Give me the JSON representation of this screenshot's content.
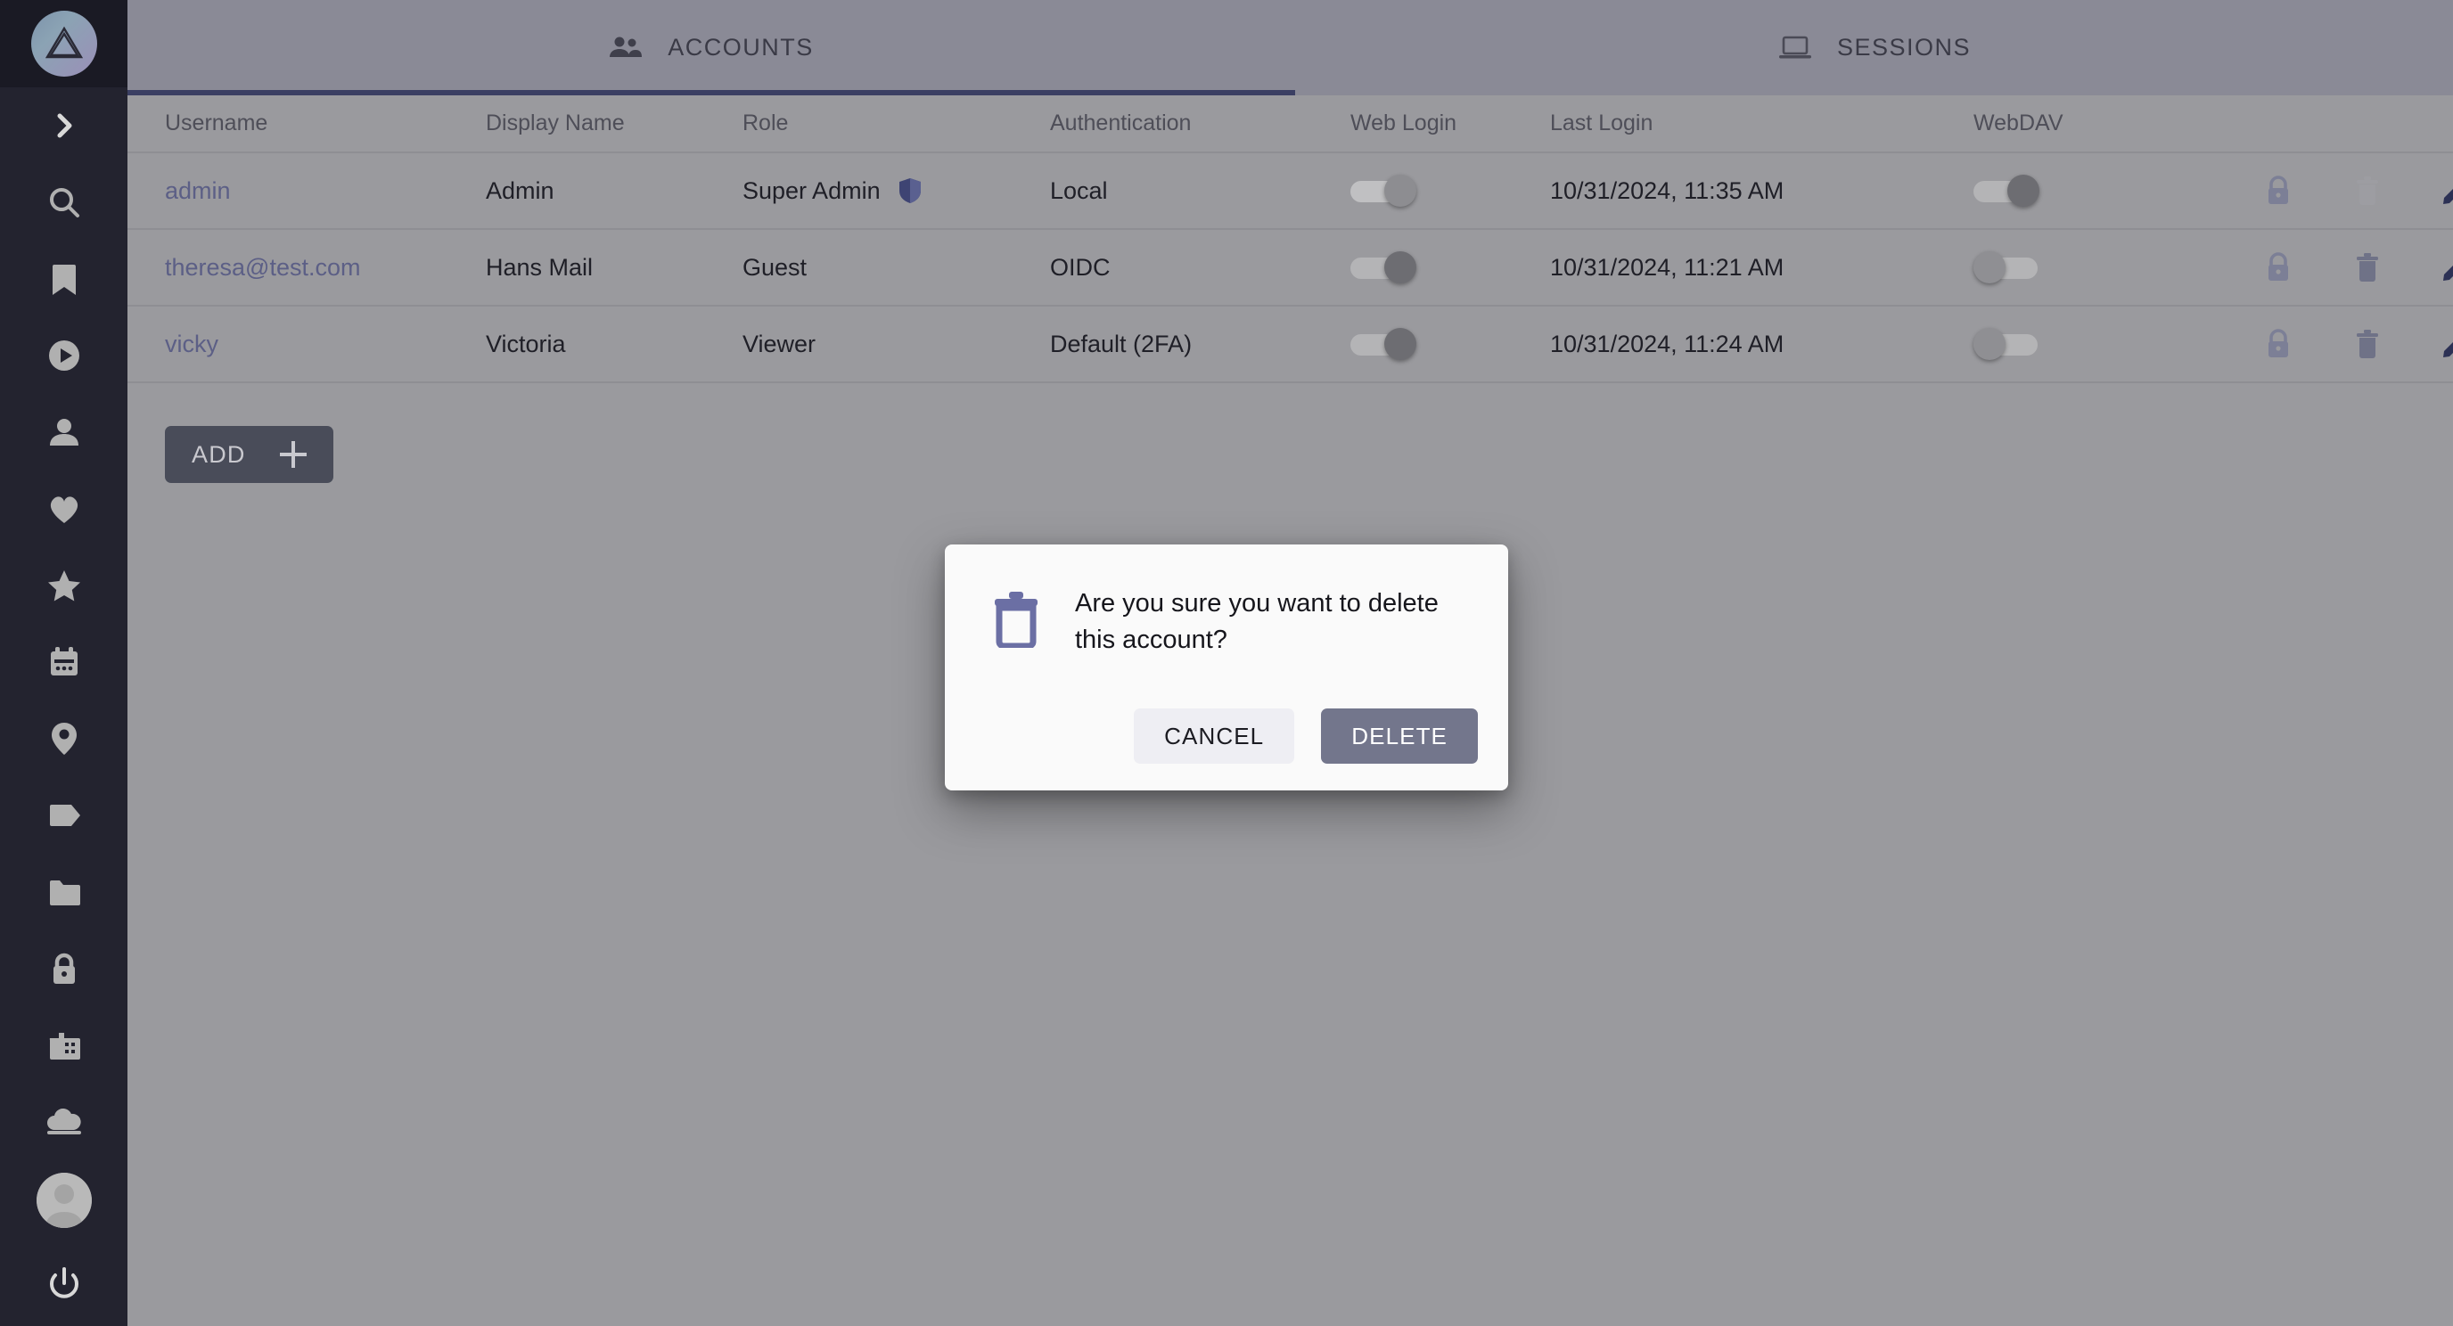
{
  "app": {
    "logo_icon": "triangle-logo-icon"
  },
  "sidebar": {
    "items": [
      {
        "icon": "chevron-right-icon",
        "name": "expand-sidebar"
      },
      {
        "icon": "search-icon",
        "name": "search"
      },
      {
        "icon": "bookmark-icon",
        "name": "bookmarks"
      },
      {
        "icon": "play-circle-icon",
        "name": "videos"
      },
      {
        "icon": "person-icon",
        "name": "people"
      },
      {
        "icon": "heart-icon",
        "name": "favorites"
      },
      {
        "icon": "star-icon",
        "name": "starred"
      },
      {
        "icon": "calendar-icon",
        "name": "calendar"
      },
      {
        "icon": "location-pin-icon",
        "name": "places"
      },
      {
        "icon": "tag-icon",
        "name": "tags"
      },
      {
        "icon": "folder-icon",
        "name": "folders"
      },
      {
        "icon": "lock-icon",
        "name": "private"
      },
      {
        "icon": "building-icon",
        "name": "archive"
      },
      {
        "icon": "cloud-upload-icon",
        "name": "upload"
      }
    ],
    "avatar_icon": "user-avatar-icon",
    "power_icon": "power-icon"
  },
  "tabs": [
    {
      "label": "ACCOUNTS",
      "icon": "people-group-icon",
      "active": true
    },
    {
      "label": "SESSIONS",
      "icon": "laptop-icon",
      "active": false
    }
  ],
  "table": {
    "columns": [
      "Username",
      "Display Name",
      "Role",
      "Authentication",
      "Web Login",
      "Last Login",
      "WebDAV"
    ],
    "rows": [
      {
        "username": "admin",
        "display_name": "Admin",
        "role": "Super Admin",
        "role_badge": "shield-icon",
        "authentication": "Local",
        "web_login": "on",
        "web_login_dim": true,
        "last_login": "10/31/2024, 11:35 AM",
        "webdav": "on",
        "webdav_dim": false,
        "delete_disabled": true
      },
      {
        "username": "theresa@test.com",
        "display_name": "Hans Mail",
        "role": "Guest",
        "role_badge": "",
        "authentication": "OIDC",
        "web_login": "on",
        "web_login_dim": false,
        "last_login": "10/31/2024, 11:21 AM",
        "webdav": "off",
        "webdav_dim": false,
        "delete_disabled": false
      },
      {
        "username": "vicky",
        "display_name": "Victoria",
        "role": "Viewer",
        "role_badge": "",
        "authentication": "Default (2FA)",
        "web_login": "on",
        "web_login_dim": false,
        "last_login": "10/31/2024, 11:24 AM",
        "webdav": "off",
        "webdav_dim": false,
        "delete_disabled": false
      }
    ],
    "row_actions": [
      {
        "icon": "lock-icon",
        "name": "reset-password"
      },
      {
        "icon": "trash-icon",
        "name": "delete-account"
      },
      {
        "icon": "pencil-icon",
        "name": "edit-account"
      }
    ],
    "add_button": {
      "label": "ADD",
      "icon": "plus-icon"
    }
  },
  "modal": {
    "icon": "trash-icon",
    "message": "Are you sure you want to delete this account?",
    "cancel_label": "CANCEL",
    "confirm_label": "DELETE"
  },
  "colors": {
    "sidebar_bg": "#23232f",
    "tabbar_bg": "#8a8a96",
    "content_bg": "#9a9a9e",
    "active_tab_underline": "#3b3f63",
    "link": "#5c5f86",
    "delete_button": "#73768c",
    "modal_icon": "#6b6fa4"
  }
}
